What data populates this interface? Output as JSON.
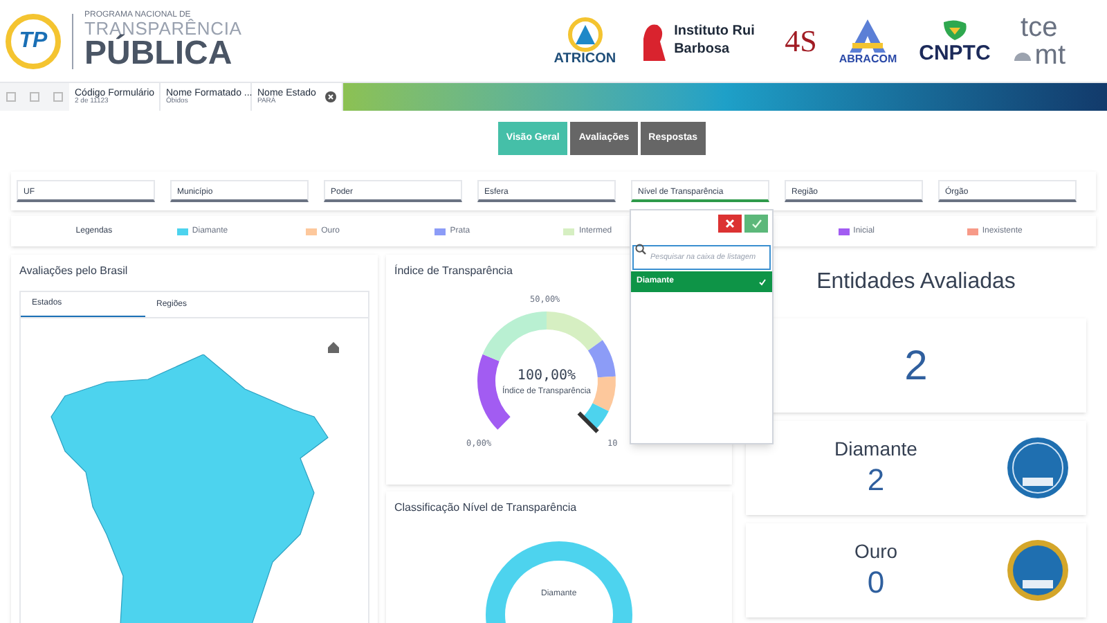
{
  "header": {
    "logo": {
      "mark": "TP",
      "line_1": "PROGRAMA NACIONAL DE",
      "line_2": "TRANSPARÊNCIA",
      "line_3": "PÚBLICA"
    },
    "partners": [
      {
        "kind": "atricon",
        "label": "ATRICON"
      },
      {
        "kind": "irb",
        "label": "Instituto Rui Barbosa"
      },
      {
        "kind": "fortyfour",
        "label": "4S"
      },
      {
        "kind": "abracom",
        "label": "ABRACOM"
      },
      {
        "kind": "cnptc",
        "label": "CNPTC"
      },
      {
        "kind": "tce",
        "label": "tce",
        "label_2": "mt"
      }
    ]
  },
  "selections": [
    {
      "title": "Código Formulário",
      "value": "2 de 11123"
    },
    {
      "title": "Nome Formatado ...",
      "value": "Óbidos"
    },
    {
      "title": "Nome Estado",
      "value": "PARÁ"
    }
  ],
  "tabs": [
    {
      "label": "Visão Geral",
      "selected": true
    },
    {
      "label": "Avaliações",
      "selected": false
    },
    {
      "label": "Respostas",
      "selected": false
    }
  ],
  "filters": [
    {
      "label": "UF",
      "active": false
    },
    {
      "label": "Município",
      "active": false
    },
    {
      "label": "Poder",
      "active": false
    },
    {
      "label": "Esfera",
      "active": false
    },
    {
      "label": "Nível de Transparência",
      "active": true
    },
    {
      "label": "Região",
      "active": false
    },
    {
      "label": "Órgão",
      "active": false
    }
  ],
  "legend": {
    "title": "Legendas",
    "items": [
      {
        "label": "Diamante",
        "color": "#4dd3ee"
      },
      {
        "label": "Ouro",
        "color": "#fdc89c"
      },
      {
        "label": "Prata",
        "color": "#8c9cf7"
      },
      {
        "label": "Intermed",
        "color": "#d6efc2"
      },
      {
        "label": "Inicial",
        "color": "#a25cf2"
      },
      {
        "label": "Inexistente",
        "color": "#f79a88"
      }
    ]
  },
  "map_panel": {
    "title": "Avaliações pelo Brasil",
    "tabs": [
      {
        "label": "Estados",
        "selected": true
      },
      {
        "label": "Regiões",
        "selected": false
      }
    ]
  },
  "gauge_panel": {
    "title": "Índice de Transparência",
    "value": "100,00%",
    "caption": "Índice de Transparência",
    "min_label": "0,00%",
    "mid_label": "50,00%",
    "max_label": "10"
  },
  "classification_panel": {
    "title": "Classificação Nível de Transparência",
    "center_label": "Diamante"
  },
  "summary": {
    "title": "Entidades Avaliadas",
    "total": "2",
    "levels": [
      {
        "label": "Diamante",
        "count": "2",
        "kind": "diamante"
      },
      {
        "label": "Ouro",
        "count": "0",
        "kind": "ouro"
      }
    ]
  },
  "dropdown": {
    "placeholder": "Pesquisar na caixa de listagem",
    "items": [
      {
        "label": "Diamante",
        "selected": true
      }
    ]
  }
}
